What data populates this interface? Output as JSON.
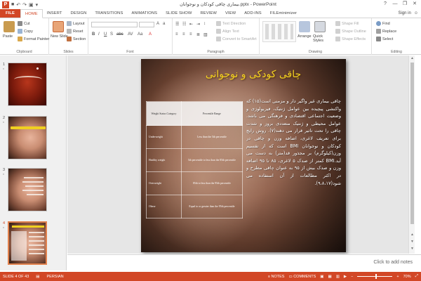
{
  "window": {
    "title": "بیماری چاقی کودکان و نوجوانان.pptx - PowerPoint",
    "app_badge": "P",
    "controls": [
      "?",
      "—",
      "❐",
      "✕"
    ]
  },
  "tabs": [
    {
      "label": "FILE"
    },
    {
      "label": "HOME"
    },
    {
      "label": "INSERT"
    },
    {
      "label": "DESIGN"
    },
    {
      "label": "TRANSITIONS"
    },
    {
      "label": "ANIMATIONS"
    },
    {
      "label": "SLIDE SHOW"
    },
    {
      "label": "REVIEW"
    },
    {
      "label": "VIEW"
    },
    {
      "label": "ADD-INS"
    },
    {
      "label": "FILEminimizer"
    }
  ],
  "signin": "Sign in",
  "ribbon": {
    "clipboard": {
      "label": "Clipboard",
      "paste": "Paste",
      "cut": "Cut",
      "copy": "Copy",
      "format_painter": "Format Painter"
    },
    "slides": {
      "label": "Slides",
      "new_slide": "New Slide",
      "layout": "Layout",
      "reset": "Reset",
      "section": "Section"
    },
    "font": {
      "label": "Font"
    },
    "paragraph": {
      "label": "Paragraph",
      "text_direction": "Text Direction",
      "align_text": "Align Text",
      "smartart": "Convert to SmartArt"
    },
    "drawing": {
      "label": "Drawing",
      "arrange": "Arrange",
      "quick_styles": "Quick Styles",
      "shape_fill": "Shape Fill",
      "shape_outline": "Shape Outline",
      "shape_effects": "Shape Effects"
    },
    "editing": {
      "label": "Editing",
      "find": "Find",
      "replace": "Replace",
      "select": "Select"
    }
  },
  "thumbnails": [
    {
      "num": "1",
      "star": "*"
    },
    {
      "num": "2",
      "star": "*"
    },
    {
      "num": "3",
      "star": "*"
    },
    {
      "num": "4",
      "star": "*"
    }
  ],
  "slide": {
    "title": "چاقی کودکی و نوجوانی",
    "table": {
      "headers": [
        "Weight Status Category",
        "Percentile Range"
      ],
      "rows": [
        [
          "Underweight",
          "Less than the 5th percentile"
        ],
        [
          "Healthy weight",
          "5th percentile to less than the 85th percentile"
        ],
        [
          "Overweight",
          "85th to less than the 95th percentile"
        ],
        [
          "Obese",
          "Equal to or greater than the 95th percentile"
        ]
      ]
    },
    "body": "چاقی بیماری غیر واگیر دار و مزمنی است(۱۵) که واکنشی پیچیده بین عوامل ژنتیک، فیزیولوژی و وضعیت اجتماعی اقتصادی و فرهنگی می باشد. عوامل محیطی و ژنتیک متعددی بروز و شدت چاقی را تحت تاثیر قرار می دهند(۷). روش رایج برای تعریف لاغری، اضافه وزن و چاقی در کودکان و نوجوانان BMI است که از تقسیم وزن(کیلوگرم) بر مجذور قد(متر) به دست می آید.BMI کمتر از صدک ۵ لاغری، ۸۵ تا ۹۵ اضافه وزن و صدک بیش از ۹۵ به عنوان چاقی مطرح و در اکثر مطالعات از آن استفاده می شود(۹،۸،۱۷)."
  },
  "notes_placeholder": "Click to add notes",
  "status": {
    "slide": "SLIDE 4 OF 43",
    "language": "PERSIAN",
    "notes": "NOTES",
    "comments": "COMMENTS",
    "zoom": "70%"
  },
  "colors": {
    "accent": "#d24726",
    "title_yellow": "#f5d320"
  }
}
